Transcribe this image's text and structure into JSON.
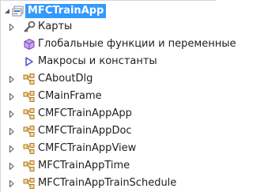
{
  "tree": {
    "root": {
      "label": "MFCTrainApp",
      "icon": "project-icon",
      "expanded": true,
      "selected": true
    },
    "items": [
      {
        "label": "Карты",
        "icon": "map-icon",
        "expandable": true
      },
      {
        "label": "Глобальные функции и переменные",
        "icon": "globals-icon",
        "expandable": false
      },
      {
        "label": "Макросы и константы",
        "icon": "macro-icon",
        "expandable": false
      },
      {
        "label": "CAboutDlg",
        "icon": "class-icon",
        "expandable": true
      },
      {
        "label": "CMainFrame",
        "icon": "class-icon",
        "expandable": true
      },
      {
        "label": "CMFCTrainAppApp",
        "icon": "class-icon",
        "expandable": true
      },
      {
        "label": "CMFCTrainAppDoc",
        "icon": "class-icon",
        "expandable": true
      },
      {
        "label": "CMFCTrainAppView",
        "icon": "class-icon",
        "expandable": true
      },
      {
        "label": "MFCTrainAppTime",
        "icon": "class-icon",
        "expandable": true
      },
      {
        "label": "MFCTrainAppTrainSchedule",
        "icon": "class-icon",
        "expandable": true
      }
    ]
  },
  "colors": {
    "selection": "#3399ff",
    "expander": "#595959",
    "class_icon": "#c08a2e",
    "macro_icon": "#5a4fd0",
    "globals_icon": "#a66ad8"
  }
}
